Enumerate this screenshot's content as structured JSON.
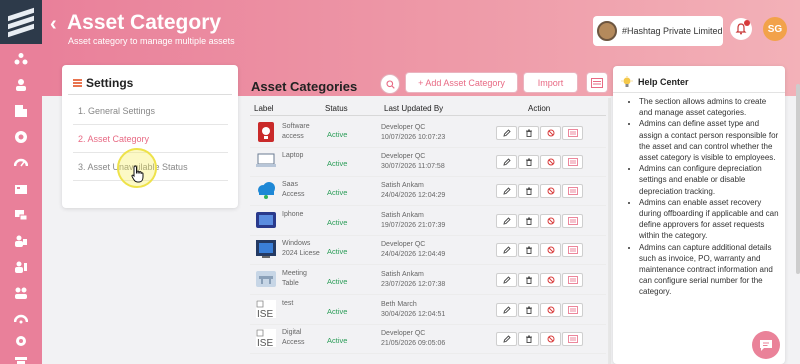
{
  "header": {
    "title": "Asset Category",
    "subtitle": "Asset category to manage multiple assets",
    "org_name": "#Hashtag Private Limited",
    "user_initials": "SG"
  },
  "settings": {
    "title": "Settings",
    "items": [
      {
        "label": "1. General Settings",
        "active": false
      },
      {
        "label": "2. Asset Category",
        "active": true
      },
      {
        "label": "3. Asset Unavailable Status",
        "active": false
      }
    ]
  },
  "main": {
    "title": "Asset Categories",
    "add_label": "+ Add Asset Category",
    "import_label": "Import",
    "columns": {
      "label": "Label",
      "status": "Status",
      "updated": "Last Updated By",
      "action": "Action"
    },
    "rows": [
      {
        "label": "Software access",
        "status": "Active",
        "user": "Developer QC",
        "date": "10/07/2026 10:07:23",
        "thumb": "software",
        "thumb_color": "#c92a2a"
      },
      {
        "label": "Laptop",
        "status": "Active",
        "user": "Developer QC",
        "date": "30/07/2026 11:07:58",
        "thumb": "laptop",
        "thumb_color": "#b8c6d8"
      },
      {
        "label": "Saas Access",
        "status": "Active",
        "user": "Satish Ankam",
        "date": "24/04/2026 12:04:29",
        "thumb": "cloud",
        "thumb_color": "#1e88d6"
      },
      {
        "label": "Iphone",
        "status": "Active",
        "user": "Satish Ankam",
        "date": "19/07/2026 21:07:39",
        "thumb": "iphone",
        "thumb_color": "#2a3a8c"
      },
      {
        "label": "Windows 2024 Licese",
        "status": "Active",
        "user": "Developer QC",
        "date": "24/04/2026 12:04:49",
        "thumb": "windows",
        "thumb_color": "#243a63"
      },
      {
        "label": "Meeting Table",
        "status": "Active",
        "user": "Satish Ankam",
        "date": "23/07/2026 12:07:38",
        "thumb": "table",
        "thumb_color": "#c7d6e6"
      },
      {
        "label": "test",
        "status": "Active",
        "user": "Beth March",
        "date": "30/04/2026 12:04:51",
        "thumb": "broken-image",
        "thumb_color": "#ffffff"
      },
      {
        "label": "Digital Access",
        "status": "Active",
        "user": "Developer QC",
        "date": "21/05/2026 09:05:06",
        "thumb": "broken-image",
        "thumb_color": "#ffffff"
      }
    ],
    "thumb_broken_text": "ISE",
    "actions": [
      "edit-icon",
      "trash-icon",
      "block-icon",
      "list-icon"
    ]
  },
  "help": {
    "title": "Help Center",
    "items": [
      "The section allows admins to create and manage asset categories.",
      "Admins can define asset type and assign a contact person responsible for the asset and can control whether the asset category is visible to employees.",
      "Admins can configure depreciation settings and enable or disable depreciation tracking.",
      "Admins can enable asset recovery during offboarding if applicable and can define approvers for asset requests within the category.",
      "Admins can capture additional details such as invoice, PO, warranty and maintenance contract information and can configure serial number for the category."
    ]
  },
  "colors": {
    "brand": "#e9809a",
    "accent": "#e86a84",
    "active": "#2a9d57"
  }
}
